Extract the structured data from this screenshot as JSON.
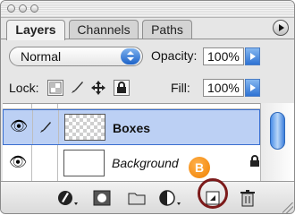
{
  "tabs": [
    {
      "label": "Layers",
      "active": true
    },
    {
      "label": "Channels",
      "active": false
    },
    {
      "label": "Paths",
      "active": false
    }
  ],
  "blend_mode": {
    "value": "Normal"
  },
  "opacity": {
    "label": "Opacity:",
    "value": "100%"
  },
  "lock": {
    "label": "Lock:"
  },
  "fill": {
    "label": "Fill:",
    "value": "100%"
  },
  "layers": [
    {
      "name": "Boxes",
      "visible": true,
      "selected": true,
      "brush_linked": true,
      "transparent_thumb": true
    },
    {
      "name": "Background",
      "visible": true,
      "selected": false,
      "locked": true,
      "transparent_thumb": false
    }
  ],
  "bottom_buttons": [
    "layer-styles",
    "add-mask",
    "new-set",
    "adjustment-layer",
    "create-new-layer",
    "delete-layer"
  ],
  "callout": {
    "label": "B",
    "color": "#f28a00",
    "ring_color": "#7c1a1a"
  },
  "colors": {
    "selected_row": "#bcd0f4",
    "selected_border": "#3a6fd0",
    "accent_blue": "#2e72d4"
  }
}
